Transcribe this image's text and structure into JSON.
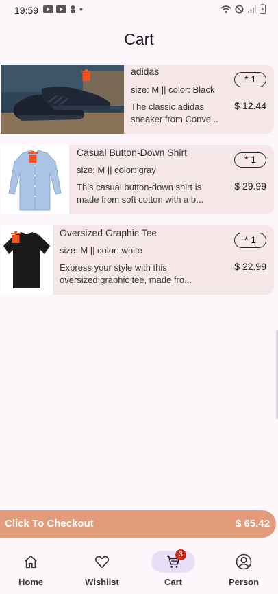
{
  "status": {
    "time": "19:59"
  },
  "page": {
    "title": "Cart"
  },
  "items": [
    {
      "name": "adidas",
      "meta": "size: M || color: Black",
      "desc_line1": "The classic adidas",
      "desc_line2": "sneaker from Conve...",
      "qty": "* 1",
      "price": "$ 12.44"
    },
    {
      "name": "Casual Button-Down Shirt",
      "meta": "size: M || color: gray",
      "desc_line1": "This casual button-down shirt is",
      "desc_line2": "made from soft cotton with a b...",
      "qty": "* 1",
      "price": "$ 29.99"
    },
    {
      "name": "Oversized Graphic Tee",
      "meta": "size: M || color: white",
      "desc_line1": "Express your style with this",
      "desc_line2": "oversized graphic tee, made fro...",
      "qty": "* 1",
      "price": "$ 22.99"
    }
  ],
  "checkout": {
    "label": "Click To Checkout",
    "total": "$ 65.42"
  },
  "nav": {
    "home": "Home",
    "wishlist": "Wishlist",
    "cart": "Cart",
    "cart_badge": "3",
    "person": "Person"
  },
  "icons": {
    "trash": "trash-icon",
    "home": "home-icon",
    "wishlist": "heart-icon",
    "cart": "cart-icon",
    "person": "person-icon"
  },
  "colors": {
    "background": "#fdf7fc",
    "card": "#f5e7e8",
    "checkout": "#e29b7b",
    "trash": "#f4541f",
    "active_nav": "#e8def8",
    "badge": "#c62e1e"
  }
}
